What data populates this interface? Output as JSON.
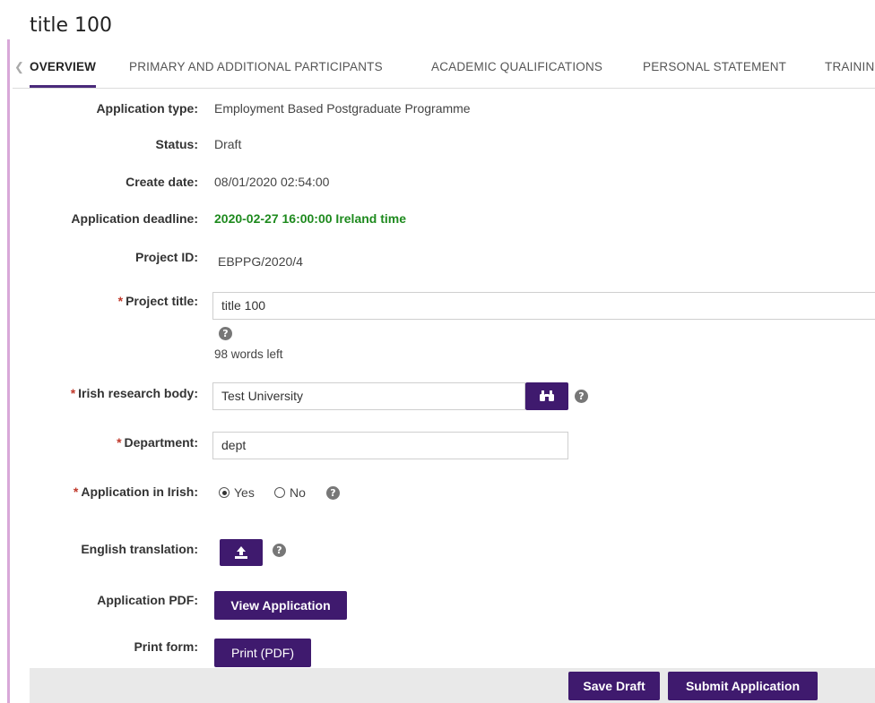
{
  "page": {
    "title": "title 100"
  },
  "tabs": [
    {
      "label": "OVERVIEW"
    },
    {
      "label": "PRIMARY AND ADDITIONAL PARTICIPANTS"
    },
    {
      "label": "ACADEMIC QUALIFICATIONS"
    },
    {
      "label": "PERSONAL STATEMENT"
    },
    {
      "label": "TRAININ"
    }
  ],
  "fields": {
    "application_type": {
      "label": "Application type:",
      "value": "Employment Based Postgraduate Programme"
    },
    "status": {
      "label": "Status:",
      "value": "Draft"
    },
    "create_date": {
      "label": "Create date:",
      "value": "08/01/2020 02:54:00"
    },
    "deadline": {
      "label": "Application deadline:",
      "value": "2020-02-27 16:00:00 Ireland time"
    },
    "project_id": {
      "label": "Project ID:",
      "value": "EBPPG/2020/4"
    },
    "project_title": {
      "label": "Project title:",
      "value": "title 100",
      "words_left": "98 words left"
    },
    "research_body": {
      "label": "Irish research body:",
      "value": "Test University"
    },
    "department": {
      "label": "Department:",
      "value": "dept"
    },
    "application_irish": {
      "label": "Application in Irish:",
      "options": [
        "Yes",
        "No"
      ],
      "selected": "Yes"
    },
    "english_translation": {
      "label": "English translation:"
    },
    "application_pdf": {
      "label": "Application PDF:",
      "button": "View Application"
    },
    "print_form": {
      "label": "Print form:",
      "button": "Print (PDF)"
    }
  },
  "footer": {
    "save_label": "Save Draft",
    "submit_label": "Submit Application"
  },
  "symbols": {
    "required": "*",
    "help": "?"
  },
  "colors": {
    "accent": "#3f1a6e",
    "deadline": "#1e8a1e",
    "required": "#c0392b"
  }
}
